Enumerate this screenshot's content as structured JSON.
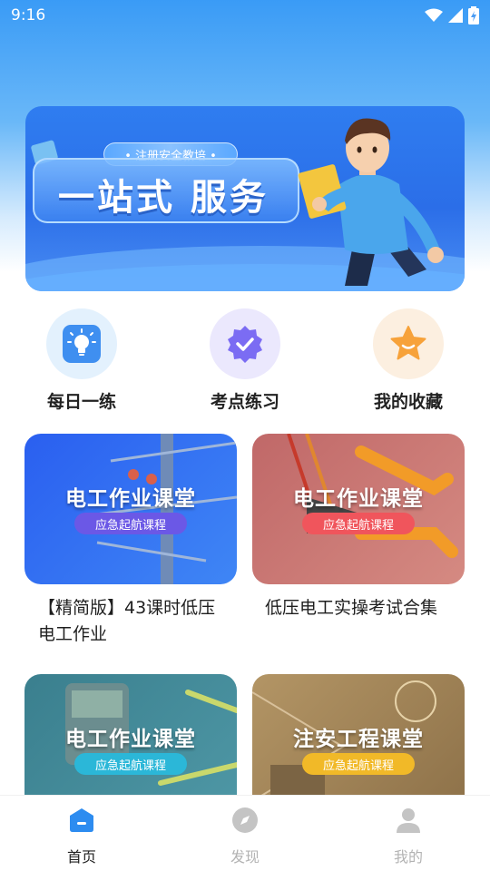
{
  "status_bar": {
    "time": "9:16"
  },
  "banner": {
    "tag": "• 注册安全教培 •",
    "title": "一站式 服务"
  },
  "quick_actions": [
    {
      "label": "每日一练",
      "icon": "lightbulb-icon",
      "bg": "#e3f1fd",
      "accent": "#3f8ff0"
    },
    {
      "label": "考点练习",
      "icon": "verified-badge-icon",
      "bg": "#ebe8fd",
      "accent": "#7b6cf3"
    },
    {
      "label": "我的收藏",
      "icon": "star-icon",
      "bg": "#fcefe0",
      "accent": "#f7a23a"
    }
  ],
  "courses": [
    {
      "card_title": "电工作业课堂",
      "card_subtitle": "应急起航课程",
      "name_line1": "【精简版】43课时低压",
      "name_line2": "电工作业",
      "bg": "#2f6cf0",
      "pill": "#6b58e6"
    },
    {
      "card_title": "电工作业课堂",
      "card_subtitle": "应急起航课程",
      "name_line1": "低压电工实操考试合集",
      "name_line2": "",
      "bg": "#c8726c",
      "pill": "#f0555c"
    },
    {
      "card_title": "电工作业课堂",
      "card_subtitle": "应急起航课程",
      "name_line1": "",
      "name_line2": "",
      "bg": "#3a7f8e",
      "pill": "#2bb7d8"
    },
    {
      "card_title": "注安工程课堂",
      "card_subtitle": "应急起航课程",
      "name_line1": "",
      "name_line2": "",
      "bg": "#a8875a",
      "pill": "#f1b928"
    }
  ],
  "tabbar": {
    "tabs": [
      {
        "label": "首页",
        "icon": "home-icon",
        "active": true
      },
      {
        "label": "发现",
        "icon": "compass-icon",
        "active": false
      },
      {
        "label": "我的",
        "icon": "profile-icon",
        "active": false
      }
    ],
    "active_color": "#2d8cf0",
    "inactive_color": "#b3b3b3"
  }
}
